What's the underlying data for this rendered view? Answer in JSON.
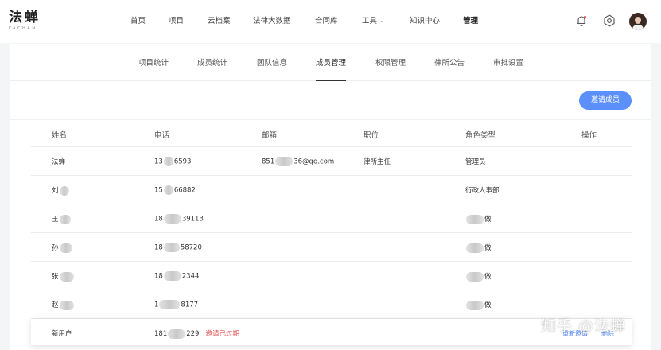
{
  "brand": {
    "name": "法蝉",
    "sub": "FACHAN"
  },
  "nav": [
    {
      "label": "首页"
    },
    {
      "label": "项目"
    },
    {
      "label": "云档案"
    },
    {
      "label": "法律大数据"
    },
    {
      "label": "合同库"
    },
    {
      "label": "工具"
    },
    {
      "label": "知识中心"
    },
    {
      "label": "管理"
    }
  ],
  "icons": {
    "bell": "bell-icon",
    "settings": "gear-icon",
    "avatar": "user-avatar"
  },
  "tabs": [
    {
      "label": "项目统计"
    },
    {
      "label": "成员统计"
    },
    {
      "label": "团队信息"
    },
    {
      "label": "成员管理"
    },
    {
      "label": "权限管理"
    },
    {
      "label": "律所公告"
    },
    {
      "label": "审批设置"
    }
  ],
  "invite_button": "邀请成员",
  "table": {
    "headers": [
      "姓名",
      "电话",
      "邮箱",
      "职位",
      "角色类型",
      "操作"
    ],
    "rows": [
      {
        "name": "法蝉",
        "phone_a": "13",
        "phone_b": "6593",
        "email_a": "851",
        "email_b": "36@qq.com",
        "title": "律所主任",
        "role": "管理员"
      },
      {
        "name": "刘",
        "phone_a": "15",
        "phone_b": "66882",
        "email_a": "",
        "email_b": "",
        "title": "",
        "role": "行政人事部"
      },
      {
        "name": "王",
        "phone_a": "18",
        "phone_b": "39113",
        "email_a": "",
        "email_b": "",
        "title": "",
        "role": "做"
      },
      {
        "name": "孙",
        "phone_a": "18",
        "phone_b": "58720",
        "email_a": "",
        "email_b": "",
        "title": "",
        "role": "做"
      },
      {
        "name": "张",
        "phone_a": "18",
        "phone_b": "2344",
        "email_a": "",
        "email_b": "",
        "title": "",
        "role": "做"
      },
      {
        "name": "赵",
        "phone_a": "1",
        "phone_b": "8177",
        "email_a": "",
        "email_b": "",
        "title": "",
        "role": "做"
      }
    ],
    "pending": {
      "name": "新用户",
      "phone_a": "181",
      "phone_b": "229",
      "status": "邀请已过期",
      "resend": "重新邀请",
      "delete": "删除"
    }
  },
  "watermark": "知乎 @法蝉"
}
